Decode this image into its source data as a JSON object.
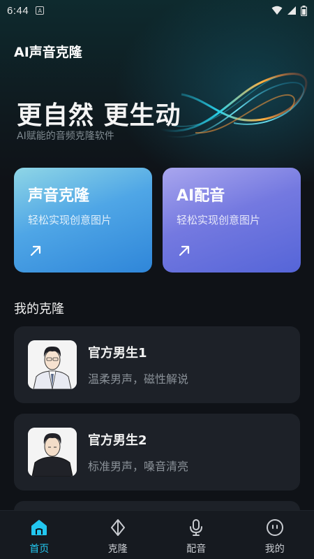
{
  "status_bar": {
    "time": "6:44",
    "notification_icon": "a-icon",
    "right_icons": [
      "wifi-icon",
      "signal-icon",
      "battery-icon"
    ]
  },
  "app": {
    "title": "AI声音克隆"
  },
  "hero": {
    "title": "更自然 更生动",
    "subtitle": "AI赋能的音频克隆软件"
  },
  "cards": [
    {
      "title": "声音克隆",
      "subtitle": "轻松实现创意图片",
      "icon": "arrow-up-right-icon",
      "color": "#4fa6e6"
    },
    {
      "title": "AI配音",
      "subtitle": "轻松实现创意图片",
      "icon": "arrow-up-right-icon",
      "color": "#7479e0"
    }
  ],
  "my_clones": {
    "section_title": "我的克隆",
    "items": [
      {
        "name": "官方男生1",
        "description": "温柔男声，磁性解说"
      },
      {
        "name": "官方男生2",
        "description": "标准男声，嗓音清亮"
      }
    ]
  },
  "bottom_nav": {
    "items": [
      {
        "label": "首页",
        "icon": "home-icon",
        "active": true
      },
      {
        "label": "克隆",
        "icon": "diamond-icon",
        "active": false
      },
      {
        "label": "配音",
        "icon": "microphone-icon",
        "active": false
      },
      {
        "label": "我的",
        "icon": "profile-face-icon",
        "active": false
      }
    ],
    "active_color": "#22c7f0"
  }
}
